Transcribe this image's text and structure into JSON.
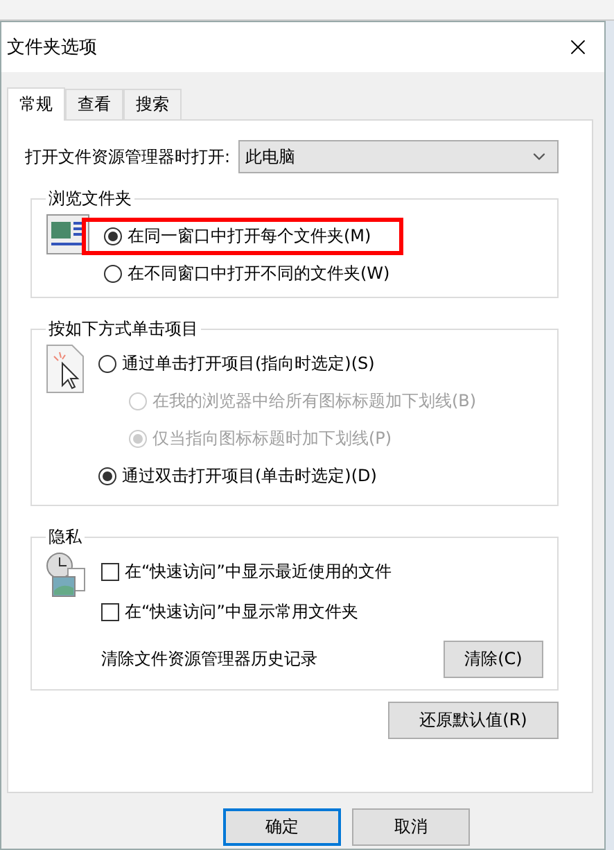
{
  "window": {
    "title": "文件夹选项"
  },
  "tabs": [
    {
      "label": "常规",
      "selected": true
    },
    {
      "label": "查看",
      "selected": false
    },
    {
      "label": "搜索",
      "selected": false
    }
  ],
  "open_in": {
    "label": "打开文件资源管理器时打开:",
    "value": "此电脑"
  },
  "browse_folders": {
    "title": "浏览文件夹",
    "options": [
      {
        "label": "在同一窗口中打开每个文件夹(M)",
        "selected": true,
        "highlighted": true
      },
      {
        "label": "在不同窗口中打开不同的文件夹(W)",
        "selected": false,
        "highlighted": false
      }
    ]
  },
  "click_items": {
    "title": "按如下方式单击项目",
    "options": [
      {
        "label": "通过单击打开项目(指向时选定)(S)",
        "selected": false,
        "disabled": false,
        "children": [
          {
            "label": "在我的浏览器中给所有图标标题加下划线(B)",
            "selected": false,
            "disabled": true
          },
          {
            "label": "仅当指向图标标题时加下划线(P)",
            "selected": true,
            "disabled": true
          }
        ]
      },
      {
        "label": "通过双击打开项目(单击时选定)(D)",
        "selected": true,
        "disabled": false
      }
    ]
  },
  "privacy": {
    "title": "隐私",
    "checkboxes": [
      {
        "label": "在“快速访问”中显示最近使用的文件",
        "checked": false
      },
      {
        "label": "在“快速访问”中显示常用文件夹",
        "checked": false
      }
    ],
    "clear_label": "清除文件资源管理器历史记录",
    "clear_button": "清除(C)"
  },
  "restore_button": "还原默认值(R)",
  "buttons": [
    {
      "label": "确定",
      "default": true
    },
    {
      "label": "取消",
      "default": false
    }
  ]
}
